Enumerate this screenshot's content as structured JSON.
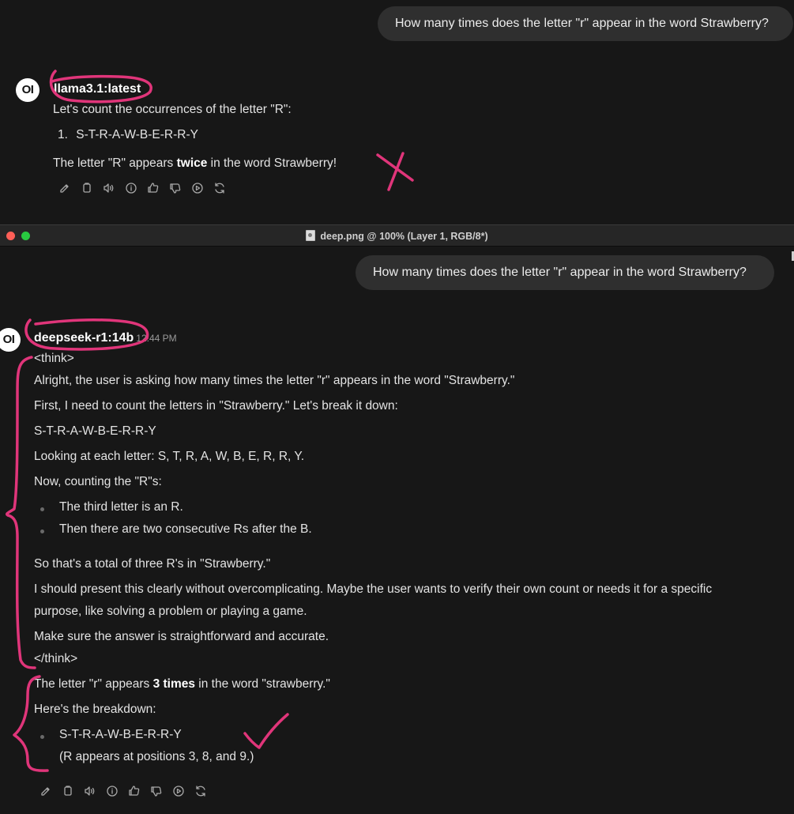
{
  "top": {
    "user_message": "How many times does the letter \"r\" appear in the word Strawberry?",
    "avatar_text": "OI",
    "model_name": "llama3.1:latest",
    "intro": "Let's count the occurrences of the letter \"R\":",
    "list_marker": "1.",
    "list_item": "S-T-R-A-W-B-E-R-R-Y",
    "answer_prefix": "The letter \"R\" appears ",
    "answer_bold": "twice",
    "answer_suffix": " in the word Strawberry!"
  },
  "titlebar": {
    "title": "deep.png @ 100% (Layer 1, RGB/8*)",
    "colors": {
      "close": "#fe5f57",
      "minimize": "#febc2e",
      "zoom": "#28c840"
    }
  },
  "bottom": {
    "user_message": "How many times does the letter \"r\" appear in the word Strawberry?",
    "avatar_text": "OI",
    "model_name": "deepseek-r1:14b",
    "timestamp": "12:44 PM",
    "think_open": "<think>",
    "think_lines": [
      "Alright, the user is asking how many times the letter \"r\" appears in the word \"Strawberry.\"",
      "First, I need to count the letters in \"Strawberry.\" Let's break it down:",
      "S-T-R-A-W-B-E-R-R-Y",
      "Looking at each letter: S, T, R, A, W, B, E, R, R, Y.",
      "Now, counting the \"R\"s:"
    ],
    "think_bullets": [
      "The third letter is an R.",
      "Then there are two consecutive Rs after the B."
    ],
    "think_after": [
      "So that's a total of three R's in \"Strawberry.\"",
      "I should present this clearly without overcomplicating. Maybe the user wants to verify their own count or needs it for a specific",
      "purpose, like solving a problem or playing a game.",
      "Make sure the answer is straightforward and accurate."
    ],
    "think_close": "</think>",
    "answer_prefix": "The letter \"r\" appears ",
    "answer_bold": "3 times",
    "answer_suffix": " in the word \"strawberry.\"",
    "breakdown_label": "Here's the breakdown:",
    "breakdown_item": "S-T-R-A-W-B-E-R-R-Y",
    "breakdown_note": "(R appears at positions 3, 8, and 9.)"
  },
  "toolbar_icons": [
    "edit-icon",
    "copy-icon",
    "read-aloud-icon",
    "info-icon",
    "thumbs-up-icon",
    "thumbs-down-icon",
    "continue-icon",
    "regenerate-icon"
  ],
  "annotation_color": "#e0357a"
}
